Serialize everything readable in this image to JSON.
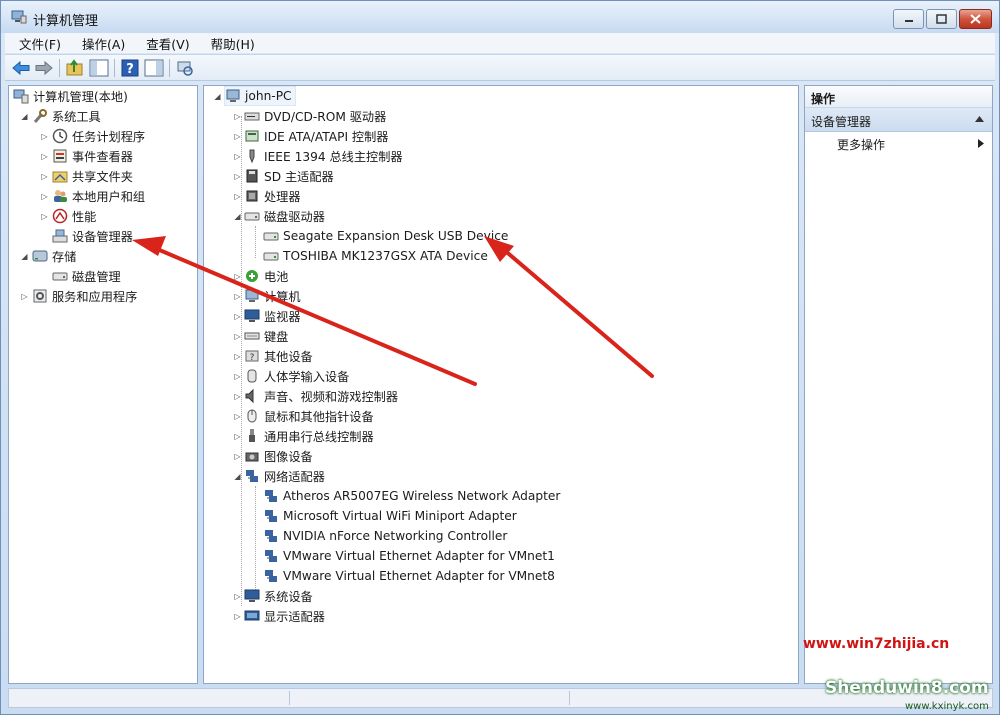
{
  "window": {
    "title": "计算机管理"
  },
  "menu": [
    "文件(F)",
    "操作(A)",
    "查看(V)",
    "帮助(H)"
  ],
  "left_tree": [
    {
      "label": "计算机管理(本地)",
      "icon": "computer-management-icon"
    },
    {
      "label": "系统工具",
      "icon": "tools-icon"
    },
    {
      "label": "任务计划程序",
      "icon": "clock-icon"
    },
    {
      "label": "事件查看器",
      "icon": "event-viewer-icon"
    },
    {
      "label": "共享文件夹",
      "icon": "shared-folder-icon"
    },
    {
      "label": "本地用户和组",
      "icon": "users-icon"
    },
    {
      "label": "性能",
      "icon": "performance-icon"
    },
    {
      "label": "设备管理器",
      "icon": "device-manager-icon"
    },
    {
      "label": "存储",
      "icon": "storage-icon"
    },
    {
      "label": "磁盘管理",
      "icon": "disk-icon"
    },
    {
      "label": "服务和应用程序",
      "icon": "services-icon"
    }
  ],
  "device_tree": {
    "root": "john-PC",
    "items": [
      "DVD/CD-ROM 驱动器",
      "IDE ATA/ATAPI 控制器",
      "IEEE 1394 总线主控制器",
      "SD 主适配器",
      "处理器",
      "磁盘驱动器",
      "Seagate Expansion Desk USB Device",
      "TOSHIBA MK1237GSX ATA Device",
      "电池",
      "计算机",
      "监视器",
      "键盘",
      "其他设备",
      "人体学输入设备",
      "声音、视频和游戏控制器",
      "鼠标和其他指针设备",
      "通用串行总线控制器",
      "图像设备",
      "网络适配器",
      "Atheros AR5007EG Wireless Network Adapter",
      "Microsoft Virtual WiFi Miniport Adapter",
      "NVIDIA nForce Networking Controller",
      "VMware Virtual Ethernet Adapter for VMnet1",
      "VMware Virtual Ethernet Adapter for VMnet8",
      "系统设备",
      "显示适配器"
    ]
  },
  "actions": {
    "header": "操作",
    "section": "设备管理器",
    "more": "更多操作"
  },
  "watermark": {
    "site": "www.win7zhijia.cn",
    "brand": "Shenduwin8.com",
    "url": "www.kxinyk.com"
  },
  "colors": {
    "arrow": "#d9241b",
    "selection": "#cde3f8"
  }
}
